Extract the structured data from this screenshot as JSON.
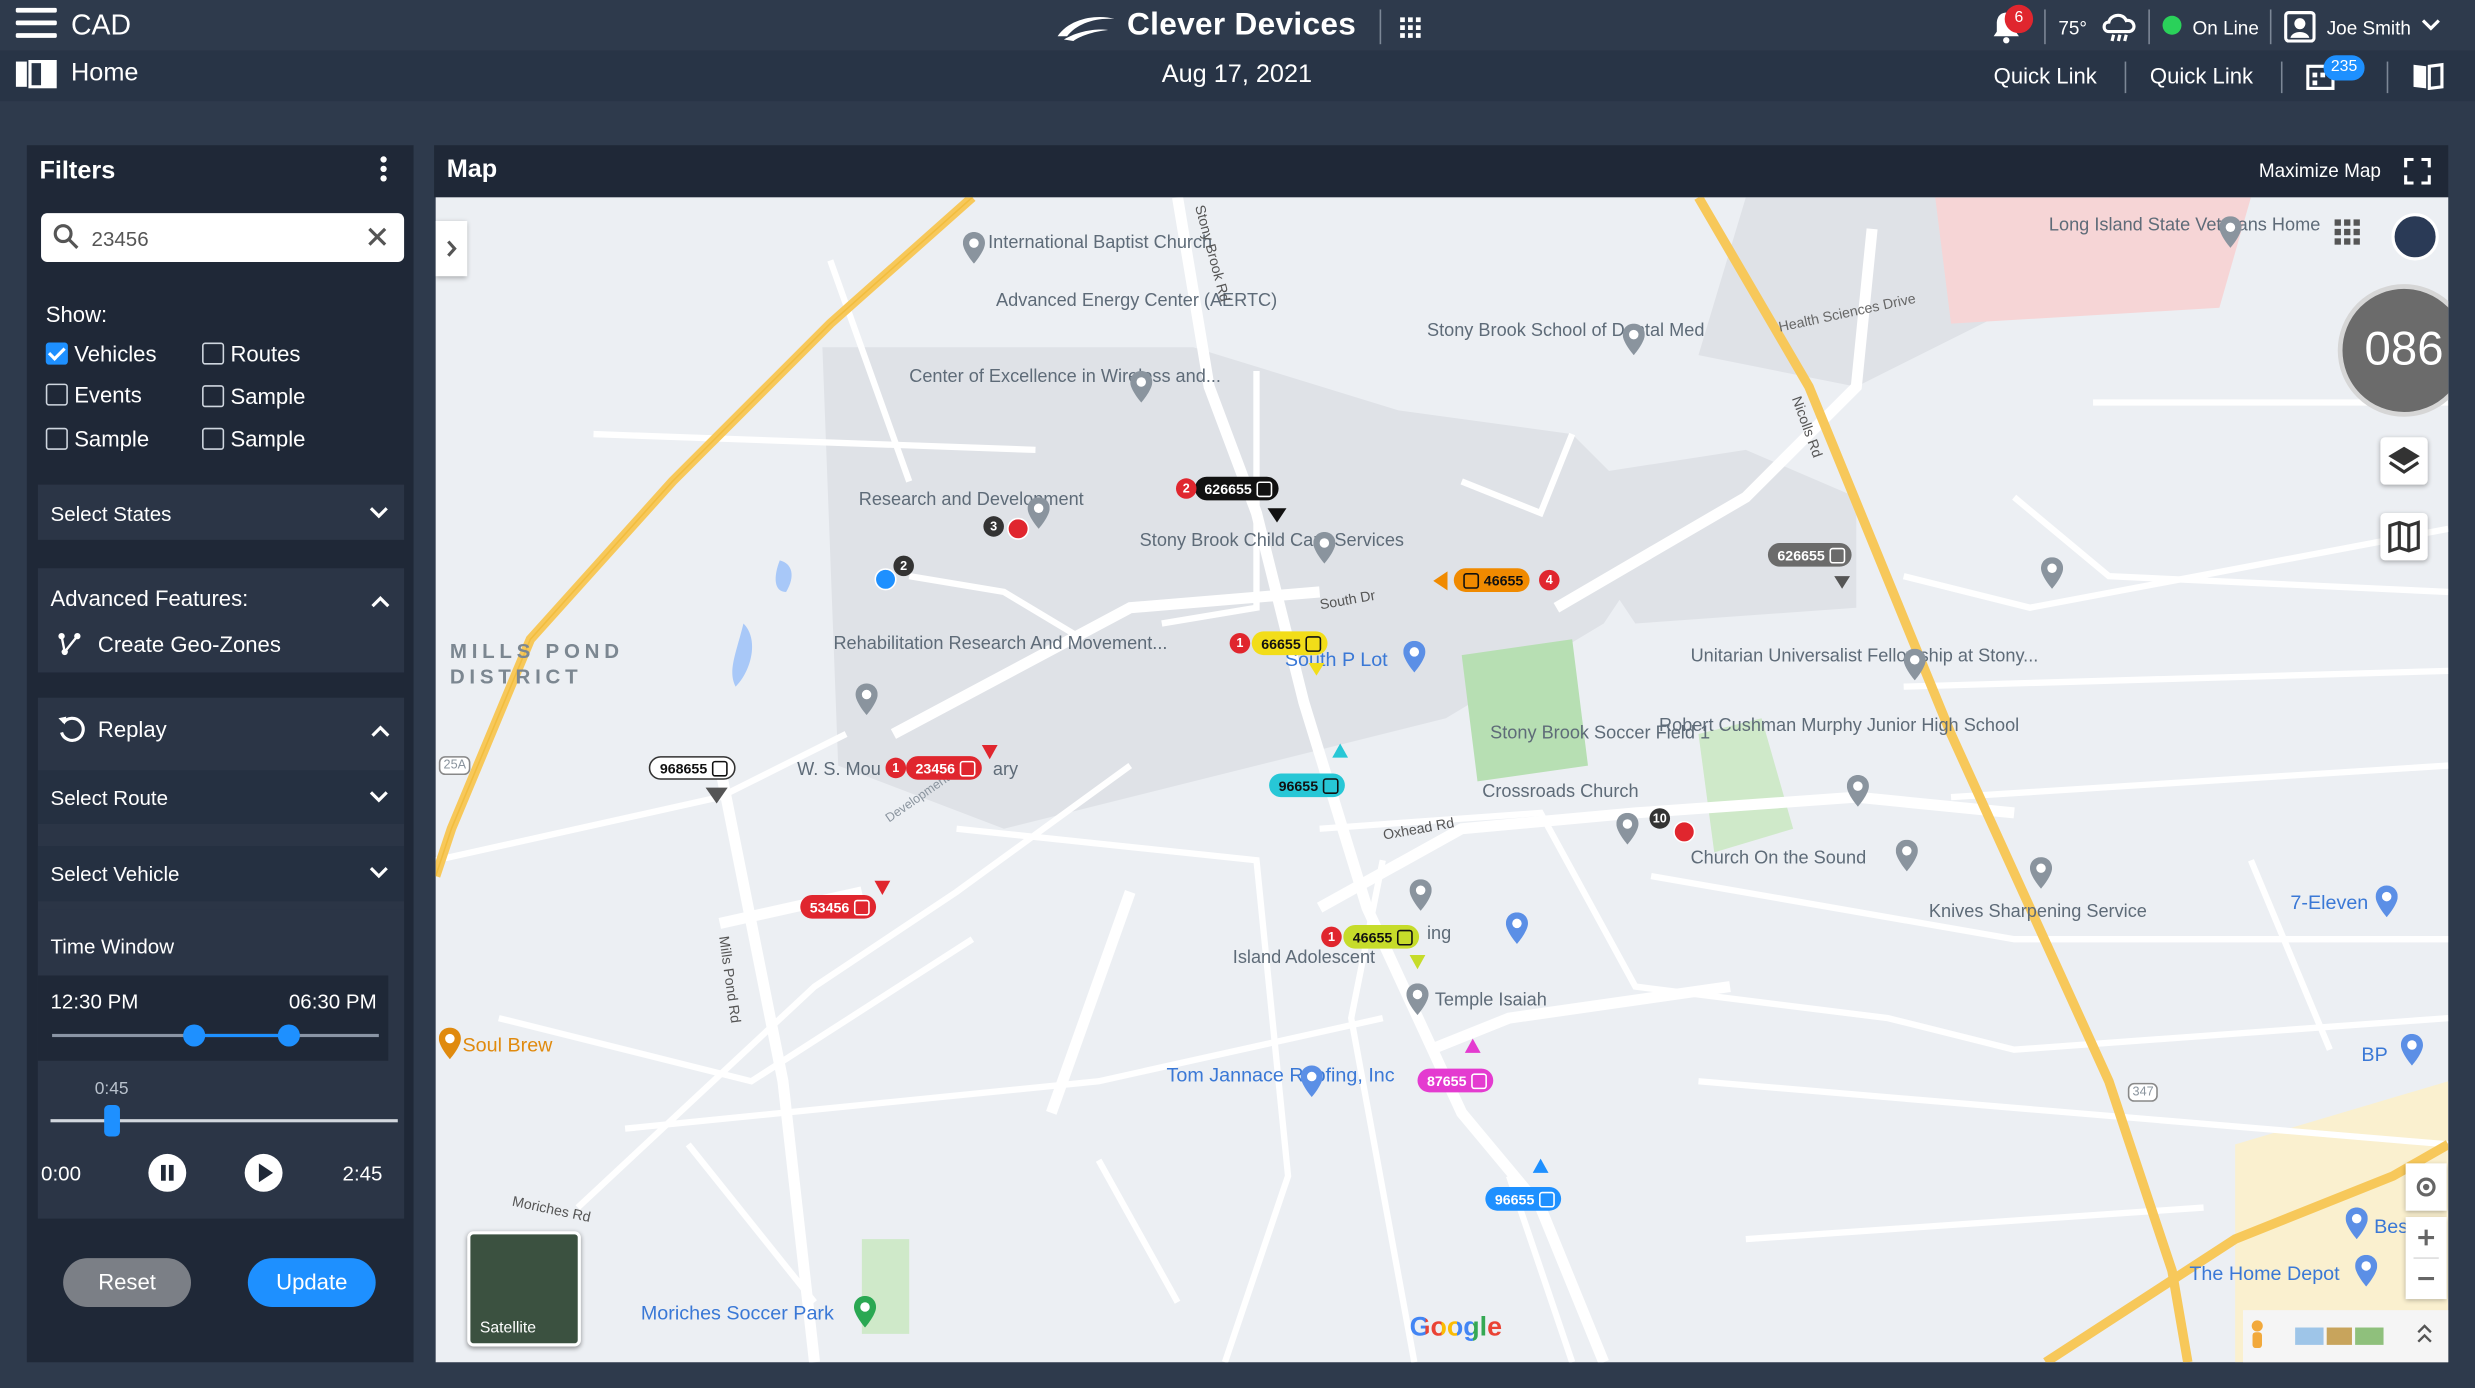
{
  "header": {
    "app_name": "CAD",
    "brand": "Clever Devices",
    "notifications_count": "6",
    "temperature": "75°",
    "status": "On Line",
    "user_name": "Joe Smith",
    "home_label": "Home",
    "date": "Aug 17, 2021",
    "quick_link_1": "Quick Link",
    "quick_link_2": "Quick Link",
    "messages_count": "235"
  },
  "filters": {
    "title": "Filters",
    "search_value": "23456",
    "show_label": "Show:",
    "checkboxes": [
      {
        "label": "Vehicles",
        "checked": true
      },
      {
        "label": "Routes",
        "checked": false
      },
      {
        "label": "Events",
        "checked": false
      },
      {
        "label": "Sample",
        "checked": false
      },
      {
        "label": "Sample",
        "checked": false
      },
      {
        "label": "Sample",
        "checked": false
      }
    ],
    "select_states": "Select States",
    "advanced_features": "Advanced Features:",
    "create_geo_zones": "Create Geo-Zones",
    "replay": "Replay",
    "select_route": "Select Route",
    "select_vehicle": "Select Vehicle",
    "time_window": "Time Window",
    "time_start": "12:30 PM",
    "time_end": "06:30 PM",
    "playback_marker": "0:45",
    "playback_start": "0:00",
    "playback_end": "2:45",
    "reset": "Reset",
    "update": "Update"
  },
  "map": {
    "title": "Map",
    "maximize": "Maximize Map",
    "speed": "086",
    "satellite": "Satellite",
    "google": "Google",
    "places": [
      "International Baptist Church",
      "Advanced Energy Center (AERTC)",
      "Center of Excellence in Wireless and...",
      "Research and Development",
      "Stony Brook Child Care Services",
      "Rehabilitation Research And Movement...",
      "W. S. Mou",
      "ary",
      "Stony Brook School of Dental Med",
      "Long Island State Veterans Home",
      "Health Sciences Drive",
      "Unitarian Universalist Fellowship at Stony...",
      "Robert Cushman Murphy Junior High School",
      "Stony Brook Soccer Field 1",
      "Crossroads Church",
      "Church On the Sound",
      "Knives Sharpening Service",
      "7-Eleven",
      "Island Adolescent",
      "ing",
      "Temple Isaiah",
      "Tom Jannace Roofing, Inc",
      "Soul Brew",
      "Moriches Soccer Park",
      "The Home Depot",
      "BP",
      "Bes",
      "South P Lot",
      "MILLS POND DISTRICT",
      "South Dr",
      "Oxhead Rd",
      "Nicolls Rd",
      "Mills Pond Rd",
      "Stony Brook Rd",
      "Moriches Rd",
      "25A",
      "347",
      "Development Drive"
    ],
    "vehicles": [
      {
        "id": "626655",
        "color": "#111111",
        "badge": "2",
        "badge_color": "#e0262e"
      },
      {
        "id": "46655",
        "color": "#f08a00",
        "badge": "4",
        "badge_color": "#e0262e"
      },
      {
        "id": "66655",
        "color": "#f2dd19",
        "badge": "1",
        "badge_color": "#e0262e"
      },
      {
        "id": "96655",
        "color": "#27c7d6",
        "badge": "",
        "badge_color": ""
      },
      {
        "id": "23456",
        "color": "#e0262e",
        "badge": "1",
        "badge_color": "#e0262e"
      },
      {
        "id": "968655",
        "color": "#ffffff",
        "badge": "",
        "badge_color": ""
      },
      {
        "id": "53456",
        "color": "#e0262e",
        "badge": "",
        "badge_color": ""
      },
      {
        "id": "46655",
        "color": "#c6dc2a",
        "badge": "1",
        "badge_color": "#e0262e"
      },
      {
        "id": "87655",
        "color": "#e43bd0",
        "badge": "",
        "badge_color": ""
      },
      {
        "id": "96655",
        "color": "#1e90ff",
        "badge": "",
        "badge_color": ""
      },
      {
        "id": "626655",
        "color": "#666666",
        "badge": "",
        "badge_color": ""
      }
    ],
    "cluster_labels": [
      "3",
      "2",
      "10"
    ]
  },
  "colors": {
    "topbar": "#2e3a4c",
    "panel": "#1f2837",
    "accent": "#1e90ff",
    "alert": "#e0262e",
    "online": "#2ad15a",
    "road_major": "#f7c85a"
  },
  "icons": [
    "hamburger-icon",
    "grid-icon",
    "bell-icon",
    "cloud-rain-icon",
    "user-icon",
    "chevron-down-icon",
    "home-icon",
    "calendar-icon",
    "book-icon",
    "search-icon",
    "close-icon",
    "kebab-icon",
    "geo-zone-icon",
    "replay-icon",
    "pause-icon",
    "play-icon",
    "expand-icon",
    "layers-icon",
    "map-icon",
    "location-icon",
    "pegman-icon"
  ]
}
